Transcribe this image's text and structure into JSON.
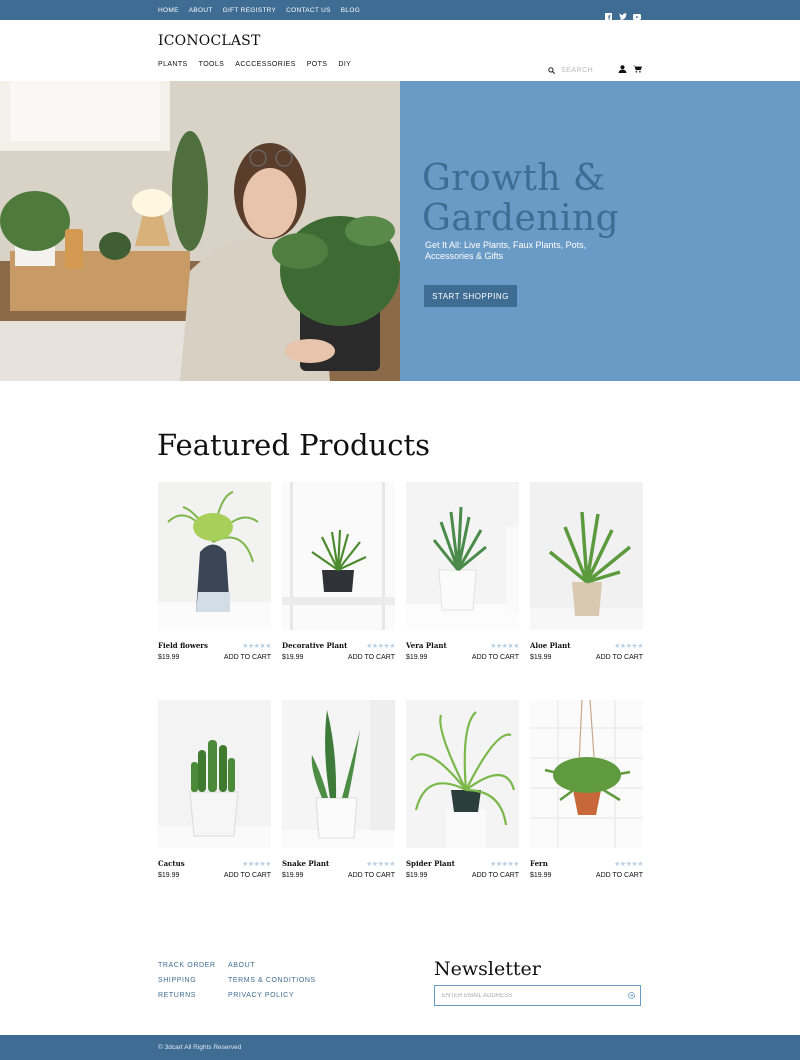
{
  "topnav": [
    "HOME",
    "ABOUT",
    "GIFT REGISTRY",
    "CONTACT US",
    "BLOG"
  ],
  "social_icons": [
    "facebook-icon",
    "twitter-icon",
    "youtube-icon"
  ],
  "brand": "ICONOCLAST",
  "mainnav": [
    "PLANTS",
    "TOOLS",
    "ACCCESSORIES",
    "POTS",
    "DIY"
  ],
  "search": {
    "placeholder": "SEARCH"
  },
  "header_icons": [
    "user-icon",
    "cart-icon"
  ],
  "hero": {
    "title_line1": "Growth &",
    "title_line2": "Gardening",
    "subtitle": "Get It All: Live Plants, Faux Plants, Pots, Accessories & Gifts",
    "button": "START SHOPPING"
  },
  "featured": {
    "title": "Featured Products",
    "products": [
      {
        "name": "Field flowers",
        "price": "$19.99",
        "cta": "ADD TO CART",
        "rating": 0
      },
      {
        "name": "Decorative Plant",
        "price": "$19.99",
        "cta": "ADD TO CART",
        "rating": 0
      },
      {
        "name": "Vera Plant",
        "price": "$19.99",
        "cta": "ADD TO CART",
        "rating": 0
      },
      {
        "name": "Aloe Plant",
        "price": "$19.99",
        "cta": "ADD TO CART",
        "rating": 0
      },
      {
        "name": "Cactus",
        "price": "$19.99",
        "cta": "ADD TO CART",
        "rating": 0
      },
      {
        "name": "Snake Plant",
        "price": "$19.99",
        "cta": "ADD TO CART",
        "rating": 0
      },
      {
        "name": "Spider Plant",
        "price": "$19.99",
        "cta": "ADD TO CART",
        "rating": 0
      },
      {
        "name": "Fern",
        "price": "$19.99",
        "cta": "ADD TO CART",
        "rating": 0
      }
    ]
  },
  "footer": {
    "col1": [
      "TRACK ORDER",
      "SHIPPING",
      "RETURNS"
    ],
    "col2": [
      "ABOUT",
      "TERMS & CONDITIONS",
      "PRIVACY POLICY"
    ],
    "newsletter_title": "Newsletter",
    "newsletter_placeholder": "ENTER EMAIL ADDRESS",
    "copyright": "© 3dcart All Rights Reserved"
  },
  "colors": {
    "primary": "#3f6c93",
    "hero_panel": "#6a9bc6",
    "stars": "#b9cfe3"
  }
}
